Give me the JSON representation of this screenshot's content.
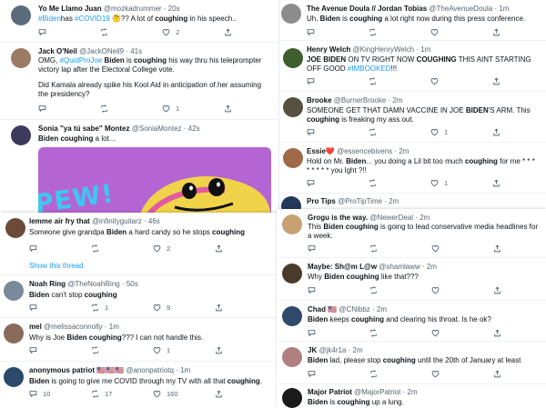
{
  "left_top": [
    {
      "name": "Yo Me Llamo Juan",
      "handle": "@mozkadrummer",
      "time": "· 20s",
      "segments": [
        [
          "tag",
          "#Biden"
        ],
        [
          "",
          "has "
        ],
        [
          "tag",
          "#COVID19"
        ],
        [
          "",
          " 🤔?? A lot of "
        ],
        [
          "b",
          "coughing"
        ],
        [
          "",
          " in his speech.."
        ]
      ],
      "actions": [
        "",
        "",
        "2",
        ""
      ]
    },
    {
      "name": "Jack O'Neil",
      "handle": "@JackONeil9",
      "time": "· 41s",
      "segments": [
        [
          "",
          "OMG, "
        ],
        [
          "tag",
          "#QuidProJoe"
        ],
        [
          "",
          " "
        ],
        [
          "b",
          "Biden"
        ],
        [
          "",
          " is "
        ],
        [
          "b",
          "coughing"
        ],
        [
          "",
          " his way thru his teleprompter victory lap after the Electoral College vote."
        ]
      ],
      "segments2": [
        [
          "",
          "Did Kamala already spike his Kool Aid in anticipation of.her assuming the presidency?"
        ]
      ],
      "actions": [
        "",
        "",
        "1",
        ""
      ]
    },
    {
      "name": "Sonia \"ya tú sabe\" Montez",
      "handle": "@SoniaMontez",
      "time": "· 42s",
      "segments": [
        [
          "b",
          "Biden coughing"
        ],
        [
          "",
          " a lot..."
        ]
      ],
      "media_text": "PEW!"
    }
  ],
  "left_bottom": [
    {
      "name": "lemme air fry that",
      "handle": "@infinityguitarz",
      "time": "· 46s",
      "segments": [
        [
          "",
          "Someone give grandpa "
        ],
        [
          "b",
          "Biden"
        ],
        [
          "",
          " a hard candy so he stops "
        ],
        [
          "b",
          "coughing"
        ]
      ],
      "actions": [
        "",
        "",
        "2",
        ""
      ],
      "show_thread": "Show this thread"
    },
    {
      "name": "Noah Ring",
      "handle": "@TheNoahRing",
      "time": "· 50s",
      "segments": [
        [
          "b",
          "Biden"
        ],
        [
          "",
          " can't stop "
        ],
        [
          "b",
          "coughing"
        ]
      ],
      "actions": [
        "",
        "1",
        "9",
        ""
      ]
    },
    {
      "name": "mel",
      "handle": "@melissaconnolly",
      "time": "· 1m",
      "segments": [
        [
          "",
          "Why is Joe "
        ],
        [
          "b",
          "Biden coughing"
        ],
        [
          "",
          "??? I can not handle this."
        ]
      ],
      "actions": [
        "",
        "",
        "1",
        ""
      ]
    },
    {
      "name": "anonymous patriot 🇺🇸🇺🇸🇺🇸",
      "handle": "@anonpatriotq",
      "time": "· 1m",
      "segments": [
        [
          "b",
          "Biden"
        ],
        [
          "",
          " is going to give me COVID through my TV with all that "
        ],
        [
          "b",
          "coughing"
        ],
        [
          "",
          "."
        ]
      ],
      "actions": [
        "10",
        "17",
        "160",
        ""
      ]
    }
  ],
  "right_top": [
    {
      "name": "The Avenue Doula // Jordan Tobias",
      "handle": "@TheAvenueDoula",
      "time": "· 1m",
      "segments": [
        [
          "",
          "Uh, "
        ],
        [
          "b",
          "Biden"
        ],
        [
          "",
          " is "
        ],
        [
          "b",
          "coughing"
        ],
        [
          "",
          " a lot right now during this press conference."
        ]
      ],
      "actions": [
        "",
        "",
        "",
        ""
      ]
    },
    {
      "name": "Henry Welch",
      "handle": "@KingHenryWelch",
      "time": "· 1m",
      "segments": [
        [
          "b",
          "JOE BIDEN"
        ],
        [
          "",
          " ON TV RIGHT NOW "
        ],
        [
          "b",
          "COUGHING"
        ],
        [
          "",
          " THIS AINT STARTING OFF GOOD "
        ],
        [
          "tag",
          "#IMBOOKED"
        ],
        [
          "",
          "!!!"
        ]
      ],
      "actions": [
        "",
        "",
        "",
        ""
      ]
    },
    {
      "name": "Brooke",
      "handle": "@BurnerBrooke",
      "time": "· 2m",
      "segments": [
        [
          "",
          "SOMEONE GET THAT DAMN VACCINE IN JOE "
        ],
        [
          "b",
          "BIDEN"
        ],
        [
          "",
          "'S ARM. This "
        ],
        [
          "b",
          "coughing"
        ],
        [
          "",
          " is freaking my ass out."
        ]
      ],
      "actions": [
        "",
        "",
        "1",
        ""
      ]
    },
    {
      "name": "Essie❤️",
      "handle": "@essencebivens",
      "time": "· 2m",
      "segments": [
        [
          "",
          "Hold on Mr. "
        ],
        [
          "b",
          "Biden"
        ],
        [
          "",
          "... you doing a Lil bit too much "
        ],
        [
          "b",
          "coughing"
        ],
        [
          "",
          " for me * * * * * * * * you lght ?!!"
        ]
      ],
      "actions": [
        "",
        "",
        "1",
        ""
      ]
    },
    {
      "name": "Pro Tips",
      "handle": "@ProTipTime",
      "time": "· 2m",
      "segments": []
    }
  ],
  "right_bottom": [
    {
      "name": "Grogu is the way.",
      "handle": "@NewerDeal",
      "time": "· 2m",
      "segments": [
        [
          "",
          "This "
        ],
        [
          "b",
          "Biden coughing"
        ],
        [
          "",
          " is going to lead conservative media headlines for a week."
        ]
      ],
      "actions": [
        "",
        "",
        "",
        ""
      ]
    },
    {
      "name": "Maybe: Sh@m L@w",
      "handle": "@shamlaww",
      "time": "· 2m",
      "segments": [
        [
          "",
          "Why "
        ],
        [
          "b",
          "Biden coughing"
        ],
        [
          "",
          " like that???"
        ]
      ],
      "actions": [
        "",
        "",
        "",
        ""
      ]
    },
    {
      "name": "Chad 🇺🇸",
      "handle": "@CNibbz",
      "time": "· 2m",
      "segments": [
        [
          "b",
          "Biden"
        ],
        [
          "",
          " keeps "
        ],
        [
          "b",
          "coughing"
        ],
        [
          "",
          " and clearing his throat. Is he ok?"
        ]
      ],
      "actions": [
        "",
        "",
        "",
        ""
      ]
    },
    {
      "name": "JK",
      "handle": "@jk4r1a",
      "time": "· 2m",
      "segments": [
        [
          "b",
          "Biden"
        ],
        [
          "",
          " lad, please stop "
        ],
        [
          "b",
          "coughing"
        ],
        [
          "",
          " until the 20th of January at least"
        ]
      ],
      "actions": [
        "",
        "",
        "",
        ""
      ]
    },
    {
      "name": "Major Patriot",
      "handle": "@MajorPatriot",
      "time": "· 2m",
      "segments": [
        [
          "b",
          "Biden"
        ],
        [
          "",
          " is "
        ],
        [
          "b",
          "coughing"
        ],
        [
          "",
          " up a lung."
        ]
      ]
    }
  ],
  "avatar_colors": {
    "lt0": "#5a6b7c",
    "lt1": "#9a7b63",
    "lt2": "#3d3a5c",
    "lb0": "#6b4a3a",
    "lb1": "#7a8a9a",
    "lb2": "#8a6a5a",
    "lb3": "#2c4a6b",
    "rt0": "#8c8c8c",
    "rt1": "#3f5e2e",
    "rt2": "#55503f",
    "rt3": "#a06a4a",
    "rt4": "#223a5c",
    "rb0": "#c6a070",
    "rb1": "#4a3a2a",
    "rb2": "#2f4a6a",
    "rb3": "#b08080",
    "rb4": "#1a1a1a"
  },
  "media_colors": {
    "bg": "#b565d3",
    "accent": "#f1d34a",
    "blue": "#3ec7f2"
  }
}
